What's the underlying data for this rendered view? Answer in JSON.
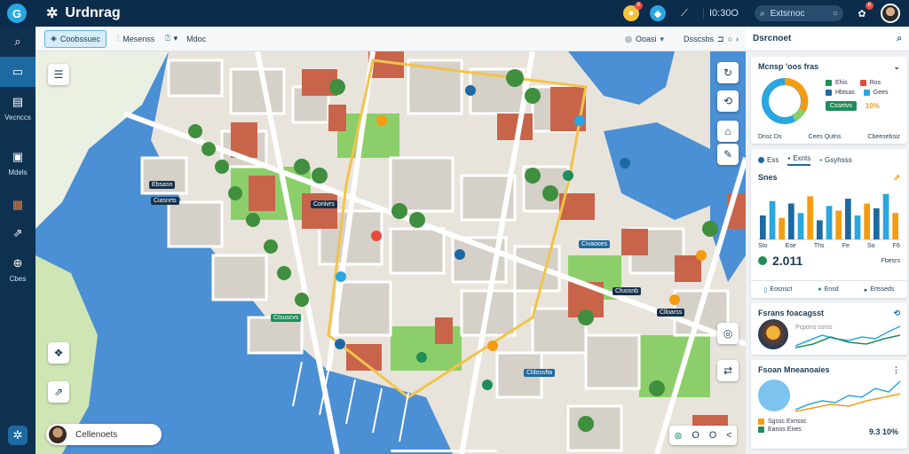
{
  "app": {
    "brand_name": "Urdnrag",
    "logo_glyph": "G",
    "brand_icon": "gear-icon"
  },
  "topbar": {
    "notif_badge": "8",
    "chat_badge": "",
    "status_text": "I0:30O",
    "search_placeholder": "Extsrnoc",
    "alert_badge": "6"
  },
  "sidebar": {
    "items": [
      {
        "label": "",
        "icon": "search-icon"
      },
      {
        "label": "",
        "icon": "folder-icon"
      },
      {
        "label": "Vecnccs",
        "icon": "map-icon"
      },
      {
        "label": "Mdels",
        "icon": "monitor-icon"
      },
      {
        "label": "",
        "icon": "calendar-icon"
      },
      {
        "label": "",
        "icon": "external-icon"
      },
      {
        "label": "Cbes",
        "icon": "globe-icon"
      },
      {
        "label": "",
        "icon": "settings-icon"
      }
    ]
  },
  "map_toolbar": {
    "layers_button": "Coobssuec",
    "item_2": "Mesenss",
    "item_3": "Mdoc",
    "right_item_1": "Ooasi",
    "right_item_2": "Dsscsbs"
  },
  "map": {
    "labels": [
      {
        "text": "Ebsasn",
        "style": "dark"
      },
      {
        "text": "Ciasnrts",
        "style": "dark"
      },
      {
        "text": "Conivrs",
        "style": "dark"
      },
      {
        "text": "Ctsuscvs",
        "style": "green"
      },
      {
        "text": "Civaooes",
        "style": "blue"
      },
      {
        "text": "Cldossfta",
        "style": "blue"
      },
      {
        "text": "Cfuosnb",
        "style": "dark"
      },
      {
        "text": "Clloarss",
        "style": "dark"
      }
    ],
    "bottom_user": "Cellenoets",
    "zoom": [
      "O",
      "O",
      "<"
    ]
  },
  "right_panel": {
    "header": "Dsrcnoet",
    "card1": {
      "title": "Mcnsp 'oos fras",
      "legend": [
        "Ehis",
        "Ros",
        "Hbtsas",
        "Gees"
      ],
      "button": "Cssetvs",
      "percent": "10%",
      "footer_left": "Dnsc Ds",
      "footer_mid": "Cees Qutns",
      "footer_right": "Cbeesebsiz"
    },
    "card2": {
      "tabs": [
        "Ess",
        "Exnts",
        "Gsyhsss"
      ],
      "title": "Snes",
      "x_labels": [
        "Sto",
        "Ese",
        "Ths",
        "Fe",
        "So",
        "F6"
      ],
      "value": "2.011",
      "value_right": "Fbesrs",
      "footer": [
        "Eosnsct",
        "Ensd",
        "Ertsseds"
      ]
    },
    "card3": {
      "title": "Fsrans foacagsst",
      "sub": "Pcpons ssrss"
    },
    "card4": {
      "title": "Fsoan Mneanoaies",
      "legend": [
        "Sgssc Exnssc",
        "Eanos Enes"
      ],
      "value": "9.3 10%"
    }
  },
  "colors": {
    "primary": "#1d6aa3",
    "topbar": "#0b2c4b",
    "water": "#4b8fd4",
    "park": "#8ccf6a",
    "roof": "#c8644a",
    "accent_orange": "#f39c12",
    "accent_green": "#1e8e5a"
  }
}
